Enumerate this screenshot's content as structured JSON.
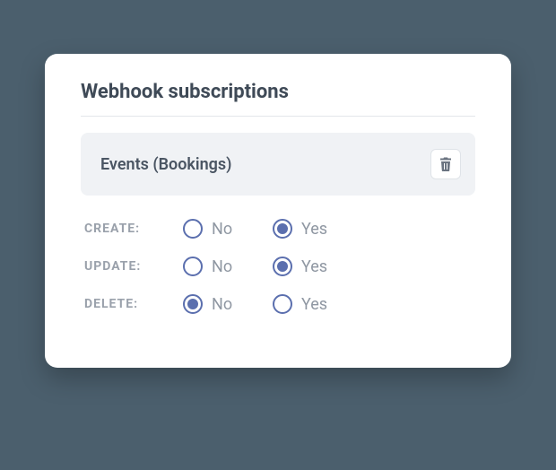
{
  "card": {
    "title": "Webhook subscriptions",
    "event_label": "Events (Bookings)"
  },
  "rows": {
    "create": {
      "label": "CREATE:",
      "no": "No",
      "yes": "Yes",
      "selected": "yes"
    },
    "update": {
      "label": "UPDATE:",
      "no": "No",
      "yes": "Yes",
      "selected": "yes"
    },
    "delete": {
      "label": "DELETE:",
      "no": "No",
      "yes": "Yes",
      "selected": "no"
    }
  }
}
